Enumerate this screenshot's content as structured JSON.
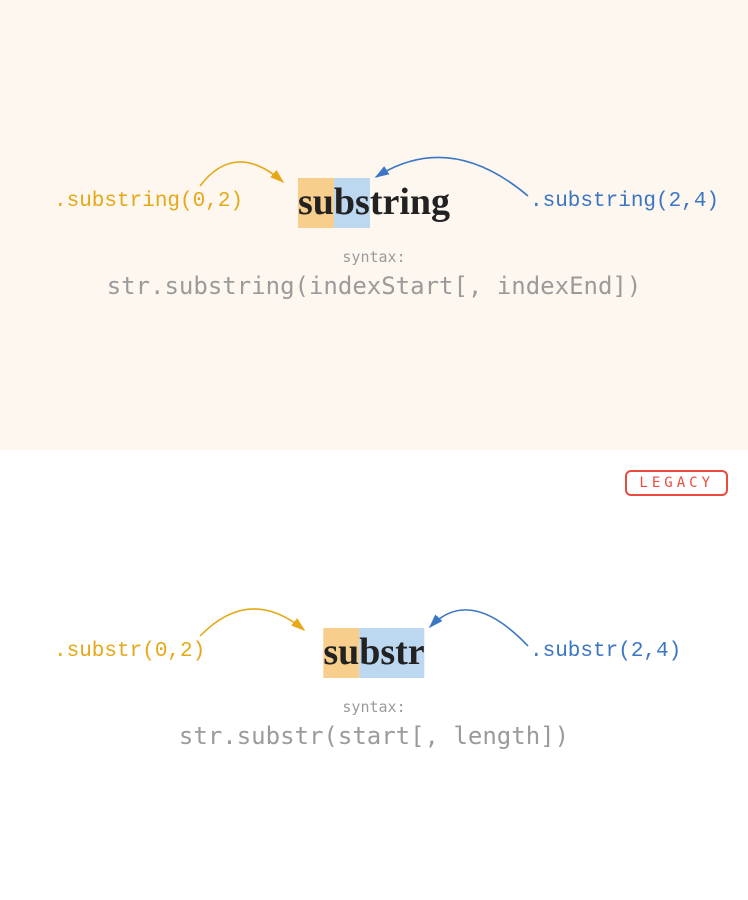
{
  "top": {
    "leftLabel": ".substring(0,2)",
    "rightLabel": ".substring(2,4)",
    "word": {
      "part1": "su",
      "part2": "bs",
      "part3": "tring"
    },
    "syntaxLabel": "syntax:",
    "syntaxText": "str.substring(indexStart[, indexEnd])",
    "colors": {
      "orange": "#e6a817",
      "blue": "#3a76c4"
    }
  },
  "bottom": {
    "badge": "LEGACY",
    "leftLabel": ".substr(0,2)",
    "rightLabel": ".substr(2,4)",
    "word": {
      "part1": "su",
      "part2": "bstr"
    },
    "syntaxLabel": "syntax:",
    "syntaxText": "str.substr(start[, length])",
    "colors": {
      "orange": "#e6a817",
      "blue": "#3a76c4"
    }
  }
}
